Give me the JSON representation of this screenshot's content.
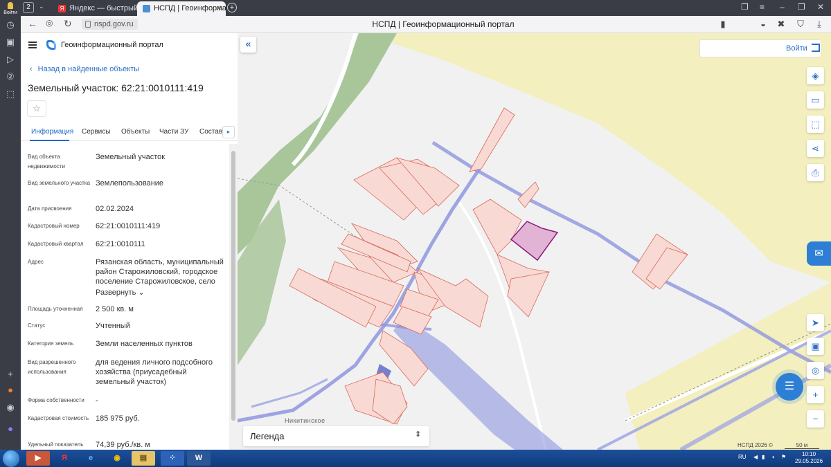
{
  "browser": {
    "tab_count": "2",
    "login_badge": "Войти",
    "tabs": [
      {
        "title": "Яндекс — быстрый поиск",
        "fav": "Я"
      },
      {
        "title": "НСПД | Геоинформац"
      }
    ],
    "url": "nspd.gov.ru",
    "page_title": "НСПД | Геоинформационный портал"
  },
  "portal": {
    "name": "Геоинформационный портал",
    "back_label": "Назад в найденные объекты",
    "title": "Земельный участок: 62:21:0010111:419",
    "tabs": [
      "Информация",
      "Сервисы",
      "Объекты",
      "Части ЗУ",
      "Состав"
    ],
    "fields": [
      {
        "label": "Вид объекта недвижимости",
        "value": "Земельный участок"
      },
      {
        "label": "Вид земельного участка",
        "value": "Землепользование"
      },
      {
        "label": "Дата присвоения",
        "value": "02.02.2024"
      },
      {
        "label": "Кадастровый номер",
        "value": "62:21:0010111:419"
      },
      {
        "label": "Кадастровый квартал",
        "value": "62:21:0010111"
      },
      {
        "label": "Адрес",
        "value": "Рязанская область, муниципальный район Старожиловский, городское поселение Старожиловское, село"
      },
      {
        "label": "Площадь уточненная",
        "value": "2 500 кв. м"
      },
      {
        "label": "Статус",
        "value": "Учтенный"
      },
      {
        "label": "Категория земель",
        "value": "Земли населенных пунктов"
      },
      {
        "label": "Вид разрешенного использования",
        "value": "для ведения личного подсобного хозяйства (приусадебный земельный участок)"
      },
      {
        "label": "Форма собственности",
        "value": "-"
      },
      {
        "label": "Кадастровая стоимость",
        "value": "185 975 руб."
      },
      {
        "label": "Удельный показатель",
        "value": "74,39 руб./кв. м"
      }
    ],
    "expand_label": "Развернуть"
  },
  "map": {
    "login_label": "Войти",
    "legend_label": "Легенда",
    "place_label": "Никитинское",
    "copyright": "НСПД 2026 ©",
    "scale_label": "50 м",
    "colors": {
      "parcel_fill": "#f8d9d4",
      "parcel_stroke": "#d8695a",
      "selected_fill": "#e3b3d6",
      "selected_stroke": "#8b1a7d",
      "road": "#8f96df",
      "forest": "#a9c69b",
      "field": "#f3efbe"
    }
  },
  "taskbar": {
    "lang": "RU",
    "time": "10:10",
    "date": "29.05.2026"
  }
}
